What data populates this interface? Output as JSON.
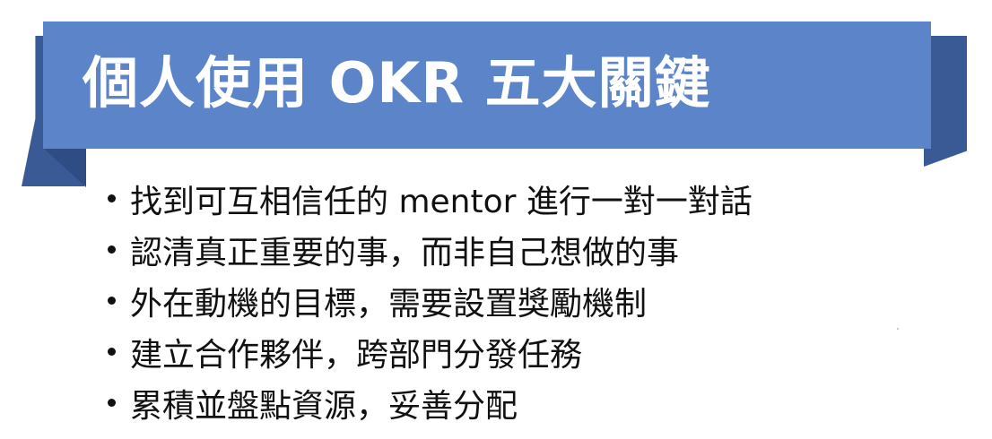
{
  "slide": {
    "title": "個人使用 OKR 五大關鍵",
    "bullets": [
      "找到可互相信任的 mentor 進行一對一對話",
      "認清真正重要的事，而非自己想做的事",
      "外在動機的目標，需要設置獎勵機制",
      "建立合作夥伴，跨部門分發任務",
      "累積並盤點資源，妥善分配"
    ]
  },
  "colors": {
    "ribbon_main": "#5b84c9",
    "ribbon_back": "#3a5a96",
    "title_text": "#ffffff",
    "body_text": "#111111",
    "background": "#ffffff"
  }
}
